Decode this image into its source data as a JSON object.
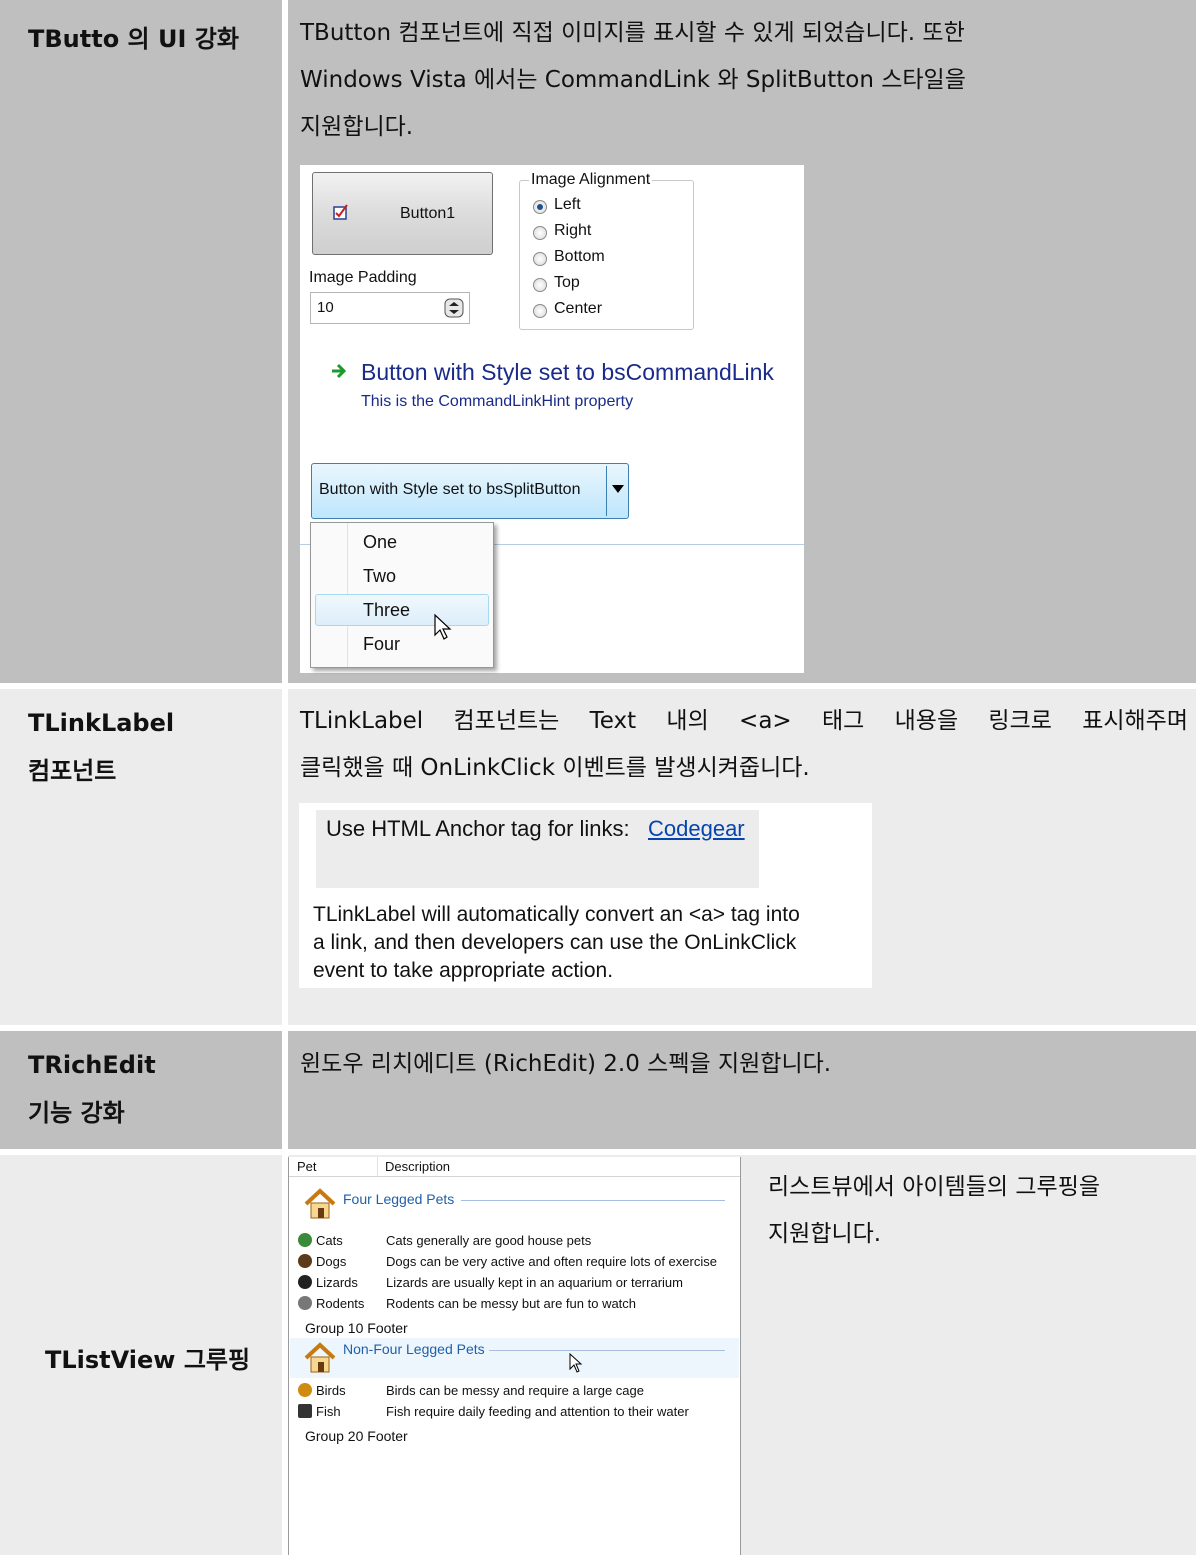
{
  "rows": [
    {
      "label": "TButto 의 UI 강화",
      "desc_lines": [
        "TButton 컴포넌트에 직접 이미지를 표시할 수 있게 되었습니다. 또한",
        "Windows Vista 에서는 CommandLink 와 SplitButton 스타일을",
        "지원합니다."
      ]
    },
    {
      "label_lines": [
        "TLinkLabel",
        "컴포넌트"
      ],
      "desc_lines": [
        "TLinkLabel 컴포넌트는 Text 내의 <a> 태그 내용을 링크로 표시해주며",
        "클릭했을 때 OnLinkClick 이벤트를 발생시켜줍니다."
      ]
    },
    {
      "label_lines": [
        "TRichEdit",
        "기능 강화"
      ],
      "desc_lines": [
        "윈도우 리치에디트 (RichEdit) 2.0 스펙을 지원합니다."
      ]
    },
    {
      "label": "TListView 그루핑",
      "desc_lines": [
        "리스트뷰에서 아이템들의 그루핑을",
        "지원합니다."
      ]
    }
  ],
  "button_demo": {
    "button1_label": "Button1",
    "image_alignment_title": "Image Alignment",
    "alignment_options": [
      "Left",
      "Right",
      "Bottom",
      "Top",
      "Center"
    ],
    "selected_alignment": "Left",
    "image_padding_label": "Image Padding",
    "image_padding_value": "10",
    "command_link_title": "Button with Style set to bsCommandLink",
    "command_link_hint": "This is the CommandLinkHint property",
    "split_button_label": "Button with Style set to bsSplitButton",
    "menu_items": [
      "One",
      "Two",
      "Three",
      "Four"
    ],
    "hovered_item": "Three"
  },
  "link_demo": {
    "prefix": "Use HTML Anchor tag for links:",
    "link_text": "Codegear",
    "body_lines": [
      "TLinkLabel will automatically convert an <a> tag into",
      "a link, and then developers can use the OnLinkClick",
      "event to take appropriate action."
    ]
  },
  "listview_demo": {
    "columns": [
      "Pet",
      "Description"
    ],
    "groups": [
      {
        "header": "Four Legged Pets",
        "items": [
          {
            "name": "Cats",
            "desc": "Cats generally are good house pets",
            "icon_color": "#3a8a3a"
          },
          {
            "name": "Dogs",
            "desc": "Dogs can be very active and often require lots of exercise",
            "icon_color": "#5a3a1a"
          },
          {
            "name": "Lizards",
            "desc": "Lizards are usually kept in an aquarium or terrarium",
            "icon_color": "#222222"
          },
          {
            "name": "Rodents",
            "desc": "Rodents can be messy but are fun to watch",
            "icon_color": "#777777"
          }
        ],
        "footer": "Group 10 Footer"
      },
      {
        "header": "Non-Four Legged Pets",
        "items": [
          {
            "name": "Birds",
            "desc": "Birds can be messy and require a large cage",
            "icon_color": "#d08a10"
          },
          {
            "name": "Fish",
            "desc": "Fish require daily feeding and attention to their water",
            "icon_color": "#333333"
          }
        ],
        "footer": "Group 20 Footer"
      }
    ]
  },
  "colors": {
    "label_cell": "#bfbfbf",
    "desc_cell_light": "#ececec",
    "link": "#0645ad",
    "group_header": "#1f5fa8",
    "command_link": "#1a2a8a"
  }
}
